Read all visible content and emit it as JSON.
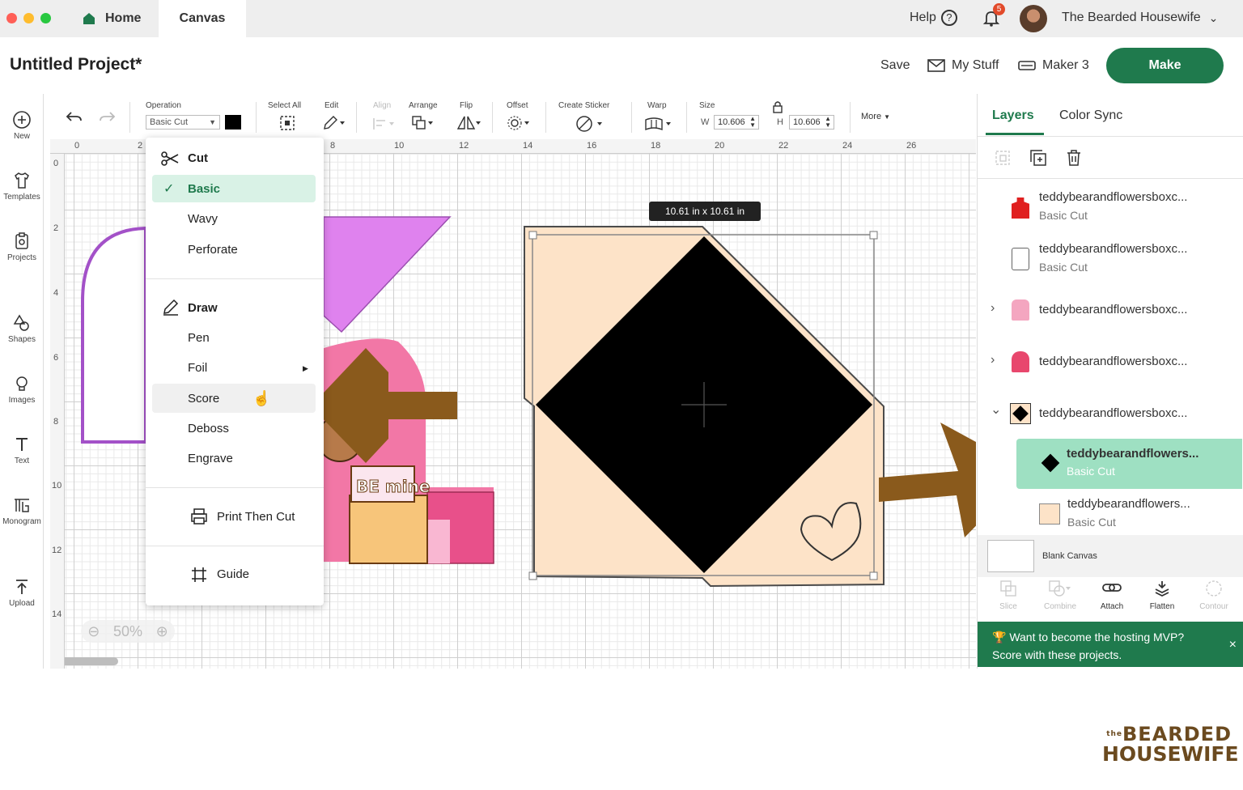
{
  "tabs": {
    "home": "Home",
    "canvas": "Canvas"
  },
  "header": {
    "help": "Help",
    "notification_count": "5",
    "user_name": "The Bearded Housewife",
    "project_title": "Untitled Project*",
    "save": "Save",
    "my_stuff": "My Stuff",
    "machine": "Maker 3",
    "make": "Make"
  },
  "sidebar": {
    "items": [
      {
        "label": "New",
        "icon": "plus-circle-icon"
      },
      {
        "label": "Templates",
        "icon": "shirt-icon"
      },
      {
        "label": "Projects",
        "icon": "clipboard-icon"
      },
      {
        "label": "Shapes",
        "icon": "shapes-icon"
      },
      {
        "label": "Images",
        "icon": "lightbulb-icon"
      },
      {
        "label": "Text",
        "icon": "text-icon"
      },
      {
        "label": "Monogram",
        "icon": "monogram-icon"
      },
      {
        "label": "Upload",
        "icon": "upload-icon"
      }
    ]
  },
  "toolbar": {
    "operation_label": "Operation",
    "operation_value": "Basic Cut",
    "select_all": "Select All",
    "edit": "Edit",
    "align": "Align",
    "arrange": "Arrange",
    "flip": "Flip",
    "offset": "Offset",
    "create_sticker": "Create Sticker",
    "warp": "Warp",
    "size": "Size",
    "w_label": "W",
    "w_value": "10.606",
    "h_label": "H",
    "h_value": "10.606",
    "more": "More"
  },
  "ruler": {
    "top": [
      "0",
      "2",
      "8",
      "10",
      "12",
      "14",
      "16",
      "18",
      "20",
      "22",
      "24",
      "26"
    ],
    "left": [
      "0",
      "2",
      "4",
      "6",
      "8",
      "10",
      "12",
      "14"
    ]
  },
  "canvas": {
    "size_tooltip": "10.61  in x 10.61  in",
    "zoom": "50%"
  },
  "operation_menu": {
    "cut_header": "Cut",
    "cut_items": [
      "Basic",
      "Wavy",
      "Perforate"
    ],
    "draw_header": "Draw",
    "draw_items": [
      "Pen",
      "Foil",
      "Score",
      "Deboss",
      "Engrave"
    ],
    "print_then_cut": "Print Then Cut",
    "guide": "Guide",
    "selected": "Basic",
    "hovered": "Score"
  },
  "layers_panel": {
    "tabs": [
      "Layers",
      "Color Sync"
    ],
    "layers": [
      {
        "name": "teddybearandflowersboxc...",
        "sub": "Basic Cut",
        "color": "#e02020"
      },
      {
        "name": "teddybearandflowersboxc...",
        "sub": "Basic Cut",
        "color": "#ffffff"
      },
      {
        "name": "teddybearandflowersboxc...",
        "sub": "",
        "color": "#f4a6c0"
      },
      {
        "name": "teddybearandflowersboxc...",
        "sub": "",
        "color": "#e8476d"
      },
      {
        "name": "teddybearandflowersboxc...",
        "sub": "",
        "color": "#000000"
      },
      {
        "name": "teddybearandflowers...",
        "sub": "Basic Cut",
        "color": "#000000"
      },
      {
        "name": "teddybearandflowers...",
        "sub": "Basic Cut",
        "color": "#fde3c8"
      }
    ],
    "blank_canvas": "Blank Canvas",
    "actions": [
      "Slice",
      "Combine",
      "Attach",
      "Flatten",
      "Contour"
    ],
    "mvp_line1": "Want to become the hosting MVP?",
    "mvp_line2": "Score with these projects.",
    "close": "×"
  },
  "watermark": {
    "line1": "BEARDED",
    "line2": "HOUSEWIFE",
    "small": "the"
  },
  "colors": {
    "accent": "#1f7a4d",
    "selected_row": "#9ee0c2",
    "arrow": "#8a5a1c",
    "envelope": "#fde3c8"
  }
}
